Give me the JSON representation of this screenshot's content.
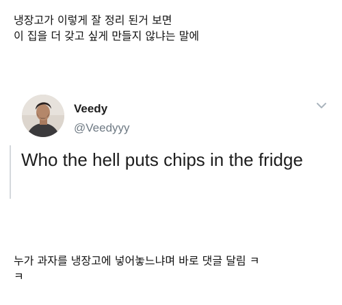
{
  "caption_top": {
    "line1": "냉장고가 이렇게 잘 정리 된거 보면",
    "line2": "이 집을 더 갖고 싶게 만들지 않냐는 말에"
  },
  "tweet": {
    "display_name": "Veedy",
    "handle": "@Veedyyy",
    "text": "Who the hell puts chips in the fridge",
    "menu_icon": "chevron-down-icon",
    "avatar_icon": "profile-photo"
  },
  "caption_bottom": {
    "line1": "누가 과자를 냉장고에 넣어놓느냐며 바로 댓글 달림 ㅋ",
    "line2": "ㅋ"
  },
  "colors": {
    "background": "#ffffff",
    "text": "#111111",
    "handle": "#6f7a84",
    "quote_bar": "#d4d8dc"
  }
}
